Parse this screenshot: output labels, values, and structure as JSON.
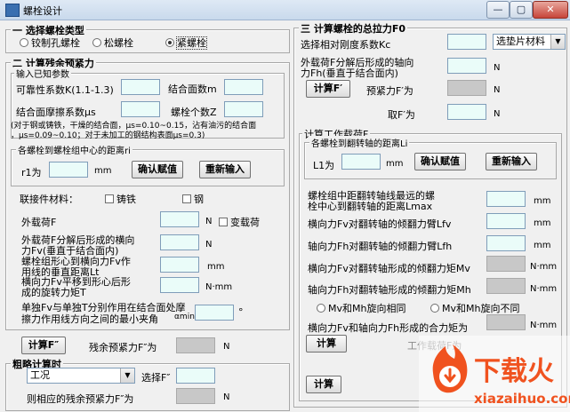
{
  "window": {
    "title": "螺栓设计",
    "minimize": "—",
    "maximize": "▢",
    "close": "✕"
  },
  "section1": {
    "title": "一 选择螺栓类型",
    "options": [
      "铰制孔螺栓",
      "松螺栓",
      "紧螺栓"
    ],
    "selected": 2
  },
  "section2": {
    "title": "二 计算残余预紧力",
    "known": {
      "title": "输入已知参数",
      "reliability_label": "可靠性系数K(1.1-1.3)",
      "joint_count_label": "结合面数m",
      "friction_label": "结合面摩擦系数μs",
      "bolt_count_label": "螺栓个数Z",
      "note_line1": "(对于钢或铸铁，干燥的结合面，μs=0.10~0.15，沾有油污的结合面",
      "note_line2": "，μs=0.09~0.10；对于未加工的钢结构表面μs=0.3)"
    },
    "distance": {
      "title": "各螺栓到螺栓组中心的距离ri",
      "r1_label": "r1为",
      "unit": "mm",
      "confirm_btn": "确认赋值",
      "reinput_btn": "重新输入"
    },
    "material": {
      "label": "联接件材料：",
      "cast_iron": "铸铁",
      "steel": "钢"
    },
    "loads": {
      "external_load_label": "外载荷F",
      "unit_n": "N",
      "variable_load": "变载荷",
      "fv_line1": "外载荷F分解后形成的横向",
      "fv_line2": "力Fv(垂直于结合面内)",
      "lt_line1": "螺栓组形心到横向力Fv作",
      "lt_line2": "用线的垂直距离Lt",
      "unit_mm": "mm",
      "t_line1": "横向力Fv平移到形心后形",
      "t_line2": "成的旋转力矩T",
      "unit_nmm": "N·mm",
      "amin_line1": "单独Fv与单独T分别作用在结合面处摩",
      "amin_line2": "擦力作用线方向之间的最小夹角",
      "amin_sub": "αmin",
      "amin_unit": "°"
    },
    "calc_btn": "计算F″",
    "residual_label": "残余预紧力F″为",
    "residual_unit": "N"
  },
  "rough": {
    "title": "粗略计算时",
    "condition": "工况",
    "choose_label": "选择F″",
    "result_label": "则相应的残余预紧力F″为",
    "unit": "N"
  },
  "section3": {
    "title": "三 计算螺栓的总拉力F0",
    "stiffness_label": "选择相对刚度系数Kc",
    "gasket_select": "选垫片材料",
    "fh_line1": "外载荷F分解后形成的轴向",
    "fh_line2": "力Fh(垂直于结合面内)",
    "unit_n": "N",
    "calc_btn": "计算F′",
    "preload_label": "预紧力F′为",
    "take_label": "取F′为",
    "work": {
      "title": "计算工作载荷F",
      "distance_title": "各螺栓到翻转轴的距离Li",
      "l1_label": "L1为",
      "unit_mm": "mm",
      "confirm_btn": "确认赋值",
      "reinput_btn": "重新输入",
      "lmax_line1": "螺栓组中距翻转轴线最远的螺",
      "lmax_line2": "栓中心到翻转轴的距离Lmax",
      "lfv_label": "横向力Fv对翻转轴的倾翻力臂Lfv",
      "lfh_label": "轴向力Fh对翻转轴的倾翻力臂Lfh",
      "mv_label": "横向力Fv对翻转轴形成的倾翻力矩Mv",
      "unit_nmm": "N·mm",
      "mh_label": "轴向力Fh对翻转轴形成的倾翻力矩Mh",
      "same_dir": "Mv和Mh旋向相同",
      "diff_dir": "Mv和Mh旋向不同",
      "resultant_label": "横向力Fv和轴向力Fh形成的合力矩为",
      "calc_btn": "计算",
      "work_load_label": "工作载荷F为"
    },
    "bottom_calc_btn": "计算"
  },
  "watermark": {
    "brand": "下载火",
    "url": "xiazaihuo.com"
  }
}
